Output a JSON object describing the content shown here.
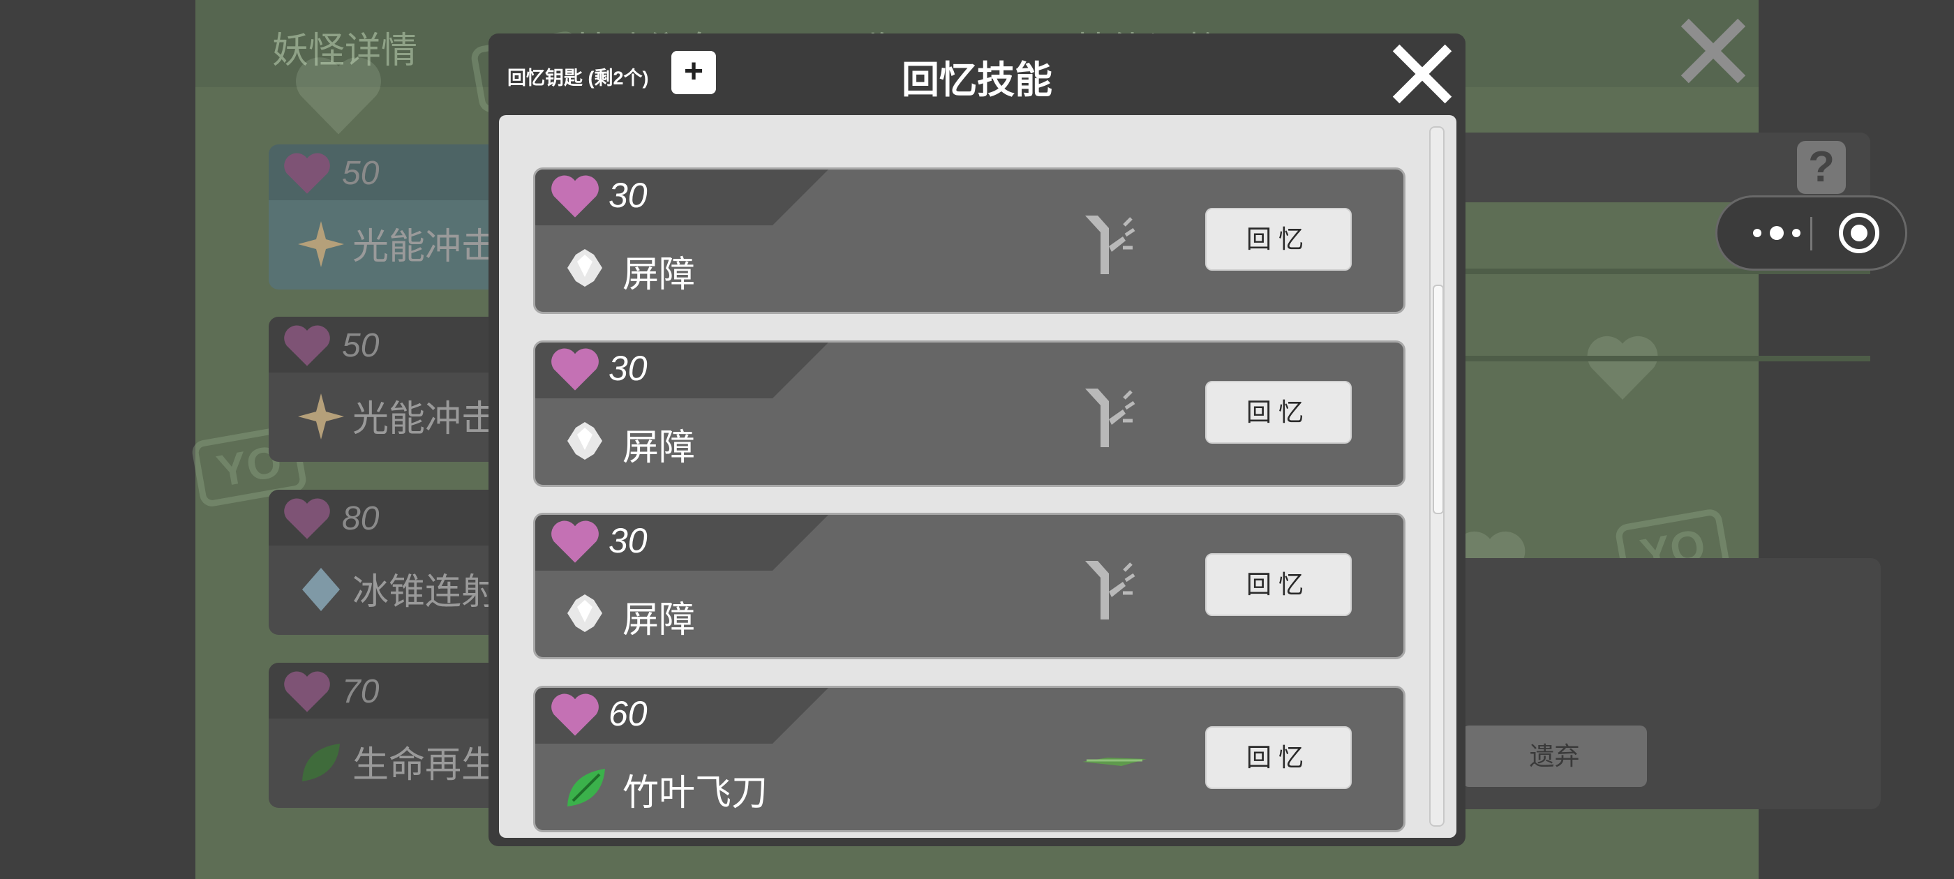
{
  "background": {
    "tabs": [
      "妖怪详情",
      "基础信息",
      "回收工具",
      "技能调整"
    ],
    "skills": [
      {
        "cost": "50",
        "name": "光能冲击",
        "icon": "light-burst-icon",
        "highlight": true
      },
      {
        "cost": "50",
        "name": "光能冲击",
        "icon": "light-burst-icon",
        "highlight": false
      },
      {
        "cost": "80",
        "name": "冰锥连射",
        "icon": "ice-shard-icon",
        "highlight": false
      },
      {
        "cost": "70",
        "name": "生命再生",
        "icon": "leaf-icon",
        "highlight": false
      }
    ],
    "help_label": "?",
    "discard_label": "遗弃"
  },
  "modal": {
    "key_label": "回忆钥匙 (剩2个)",
    "add_label": "+",
    "title": "回忆技能",
    "cards": [
      {
        "cost": "30",
        "name": "屏障",
        "icon": "barrier-orb-icon",
        "type_icon": "branch-type-icon",
        "button": "回忆"
      },
      {
        "cost": "30",
        "name": "屏障",
        "icon": "barrier-orb-icon",
        "type_icon": "branch-type-icon",
        "button": "回忆"
      },
      {
        "cost": "30",
        "name": "屏障",
        "icon": "barrier-orb-icon",
        "type_icon": "branch-type-icon",
        "button": "回忆"
      },
      {
        "cost": "60",
        "name": "竹叶飞刀",
        "icon": "bamboo-leaf-icon",
        "type_icon": "blade-type-icon",
        "button": "回忆"
      }
    ]
  },
  "colors": {
    "heart": "#c471b4",
    "modal_bg": "#3c3c3c",
    "card_bg": "#666666",
    "page_bg": "#5e6e55"
  }
}
